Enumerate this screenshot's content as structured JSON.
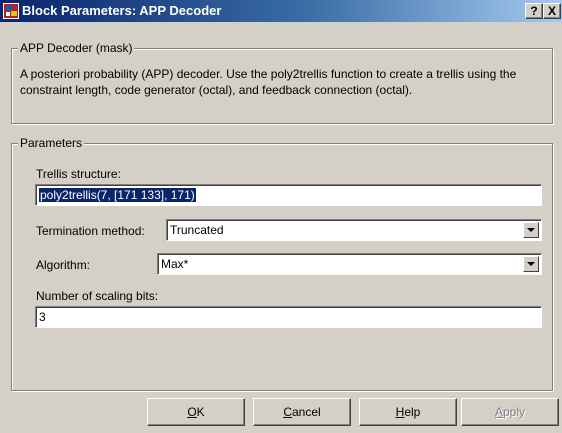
{
  "window": {
    "title": "Block Parameters: APP Decoder",
    "help_button": "?",
    "close_button": "X"
  },
  "mask_group": {
    "label": "APP Decoder (mask)",
    "description": "A posteriori probability (APP) decoder. Use the poly2trellis function to create a trellis using the constraint length, code generator (octal), and feedback connection (octal)."
  },
  "parameters_group": {
    "label": "Parameters",
    "trellis_structure": {
      "label": "Trellis structure:",
      "value": "poly2trellis(7, [171 133], 171)"
    },
    "termination_method": {
      "label": "Termination method:",
      "value": "Truncated"
    },
    "algorithm": {
      "label": "Algorithm:",
      "value": "Max*"
    },
    "scaling_bits": {
      "label": "Number of scaling bits:",
      "value": "3"
    }
  },
  "buttons": {
    "ok": "OK",
    "cancel": "Cancel",
    "help": "Help",
    "apply": "Apply"
  },
  "colors": {
    "titlebar_start": "#0a246a",
    "titlebar_end": "#a6caf0",
    "dialog_face": "#d4d0c8",
    "selection": "#0a246a"
  }
}
